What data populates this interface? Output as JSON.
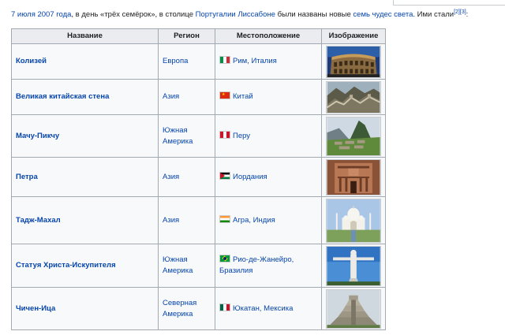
{
  "intro": {
    "date_link": "7 июля 2007 года",
    "text1": ", в день «трёх семёрок», в столице ",
    "country_link": "Португалии",
    "space": " ",
    "city_link": "Лиссабоне",
    "text2": " были названы новые ",
    "wonders_link": "семь чудес света",
    "text3": ". Ими стали",
    "ref1": "[2]",
    "ref2": "[3]",
    "text4": ":"
  },
  "table": {
    "headers": [
      "Название",
      "Регион",
      "Местоположение",
      "Изображение"
    ],
    "rows": [
      {
        "name": "Колизей",
        "region": "Европа",
        "location": "Рим, Италия",
        "flag": "italy-flag-icon",
        "image": "colosseum-image"
      },
      {
        "name": "Великая китайская стена",
        "region": "Азия",
        "location": "Китай",
        "flag": "china-flag-icon",
        "image": "great-wall-image"
      },
      {
        "name": "Мачу-Пикчу",
        "region": "Южная Америка",
        "location": "Перу",
        "flag": "peru-flag-icon",
        "image": "machu-picchu-image"
      },
      {
        "name": "Петра",
        "region": "Азия",
        "location": "Иордания",
        "flag": "jordan-flag-icon",
        "image": "petra-image"
      },
      {
        "name": "Тадж-Махал",
        "region": "Азия",
        "location": "Агра, Индия",
        "flag": "india-flag-icon",
        "image": "taj-mahal-image"
      },
      {
        "name": "Статуя Христа-Искупителя",
        "region": "Южная Америка",
        "location": "Рио-де-Жанейро, Бразилия",
        "flag": "brazil-flag-icon",
        "image": "christ-redeemer-image"
      },
      {
        "name": "Чичен-Ица",
        "region": "Северная Америка",
        "location": "Юкатан, Мексика",
        "flag": "mexico-flag-icon",
        "image": "chichen-itza-image"
      }
    ]
  },
  "colors": {
    "link": "#0645ad",
    "text": "#202122",
    "header_bg": "#eaecf0",
    "table_bg": "#f8f9fa",
    "border": "#a2a9b1"
  }
}
